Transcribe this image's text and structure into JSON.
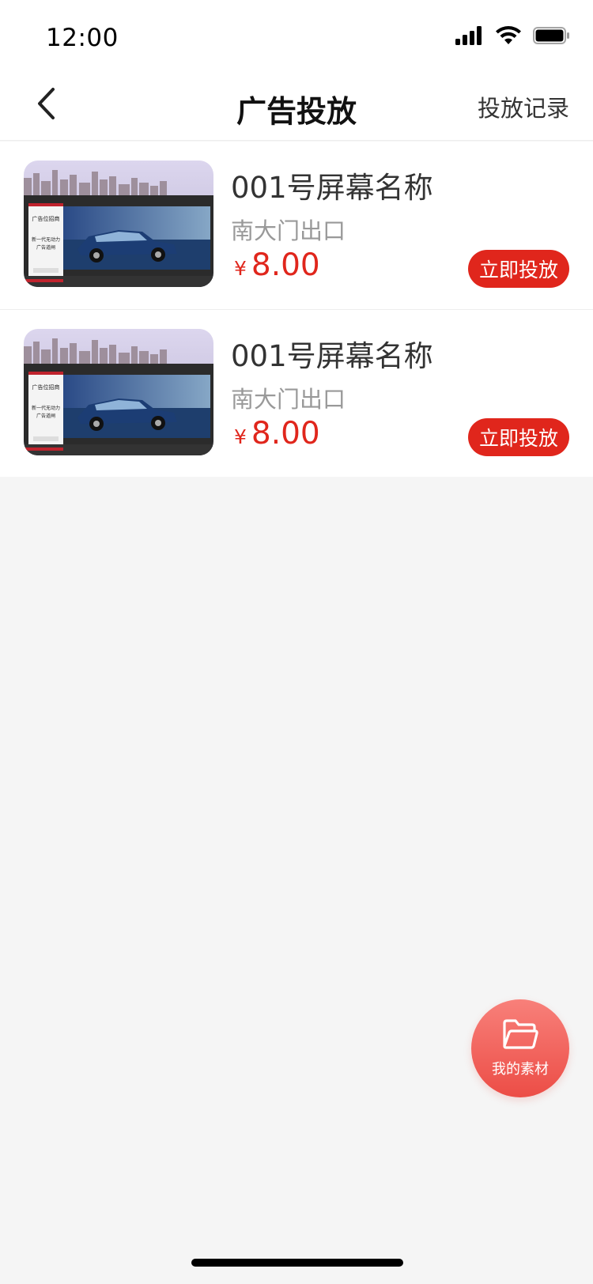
{
  "status_bar": {
    "time": "12:00",
    "icons": [
      "signal-icon",
      "wifi-icon",
      "battery-icon"
    ]
  },
  "nav": {
    "back_icon": "chevron-left-icon",
    "title": "广告投放",
    "right_label": "投放记录"
  },
  "list": {
    "items": [
      {
        "name": "001号屏幕名称",
        "location": "南大门出口",
        "currency": "¥",
        "price": "8.00",
        "button_label": "立即投放",
        "image_icon": "billboard-car-image",
        "billboard_text_1": "广告位招商",
        "billboard_text_2": "新一代无动力\n广告道闸"
      },
      {
        "name": "001号屏幕名称",
        "location": "南大门出口",
        "currency": "¥",
        "price": "8.00",
        "button_label": "立即投放",
        "image_icon": "billboard-car-image",
        "billboard_text_1": "广告位招商",
        "billboard_text_2": "新一代无动力\n广告道闸"
      }
    ]
  },
  "fab": {
    "icon": "folder-icon",
    "label": "我的素材"
  },
  "colors": {
    "accent": "#e0261c",
    "fab_top": "#f8807a",
    "fab_bottom": "#ec4d46",
    "background": "#f5f5f5"
  }
}
